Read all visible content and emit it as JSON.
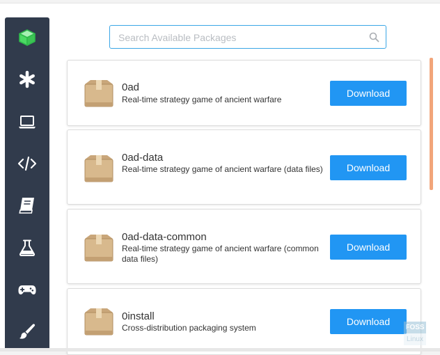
{
  "search": {
    "placeholder": "Search Available Packages"
  },
  "sidebar": {
    "items": [
      {
        "icon": "cube-icon",
        "active": true
      },
      {
        "icon": "asterisk-icon"
      },
      {
        "icon": "laptop-icon"
      },
      {
        "icon": "code-icon"
      },
      {
        "icon": "book-icon"
      },
      {
        "icon": "flask-icon"
      },
      {
        "icon": "gamepad-icon"
      },
      {
        "icon": "brush-icon"
      }
    ]
  },
  "packages": [
    {
      "name": "0ad",
      "description": "Real-time strategy game of ancient warfare",
      "button": "Download"
    },
    {
      "name": "0ad-data",
      "description": "Real-time strategy game of ancient warfare (data files)",
      "button": "Download"
    },
    {
      "name": "0ad-data-common",
      "description": "Real-time strategy game of ancient warfare (common data files)",
      "button": "Download"
    },
    {
      "name": "0install",
      "description": "Cross-distribution packaging system",
      "button": "Download"
    }
  ],
  "watermark": {
    "line1": "FOSS",
    "line2": "Linux"
  },
  "colors": {
    "sidebar_bg": "#313b4c",
    "sidebar_icon": "#ffffff",
    "active_icon": "#4cd964",
    "accent_button": "#2196f3",
    "search_border": "#3aa6e6",
    "scroll_thumb": "#f2a57a"
  }
}
